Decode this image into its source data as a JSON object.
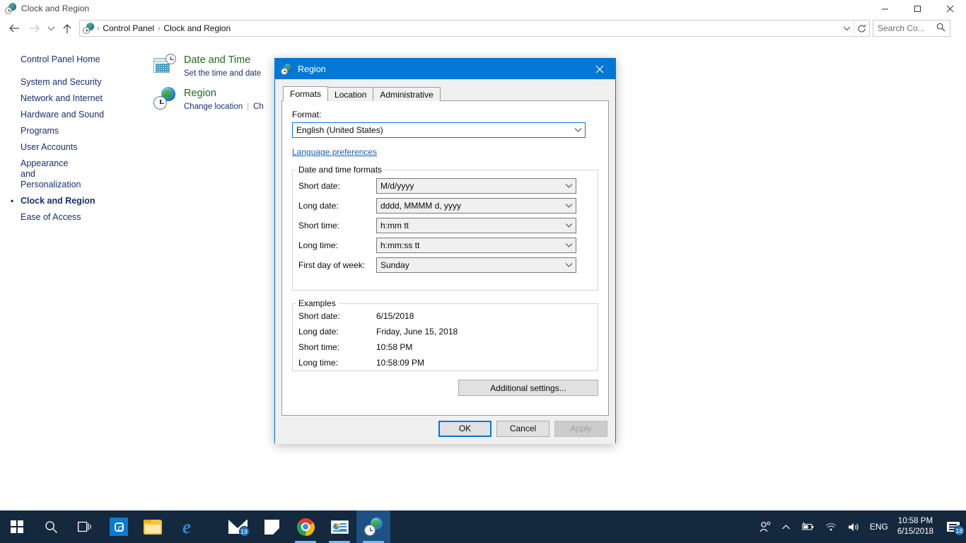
{
  "window": {
    "title": "Clock and Region",
    "icon": "clock-region-icon",
    "buttons": {
      "minimize": "—",
      "maximize": "❑",
      "close": "✕"
    }
  },
  "nav": {
    "back": "←",
    "forward": "→",
    "recent": "⌄",
    "up": "↑",
    "breadcrumb": [
      "Control Panel",
      "Clock and Region"
    ],
    "separator": "›",
    "dropdown": "⌄",
    "refresh": "↻"
  },
  "search": {
    "placeholder": "Search Co...",
    "icon": "search-icon",
    "icon_glyph": "⚲"
  },
  "sidebar": {
    "home": "Control Panel Home",
    "items": [
      {
        "label": "System and Security",
        "current": false
      },
      {
        "label": "Network and Internet",
        "current": false
      },
      {
        "label": "Hardware and Sound",
        "current": false
      },
      {
        "label": "Programs",
        "current": false
      },
      {
        "label": "User Accounts",
        "current": false
      },
      {
        "label": "Appearance and Personalization",
        "current": false
      },
      {
        "label": "Clock and Region",
        "current": true
      },
      {
        "label": "Ease of Access",
        "current": false
      }
    ]
  },
  "content": {
    "items": [
      {
        "title": "Date and Time",
        "icon": "date-and-time-icon",
        "links": [
          "Set the time and date"
        ]
      },
      {
        "title": "Region",
        "icon": "region-icon",
        "links": [
          "Change location",
          "Ch"
        ]
      }
    ]
  },
  "dialog": {
    "title": "Region",
    "icon": "region-icon",
    "close": "✕",
    "tabs": [
      {
        "label": "Formats",
        "active": true
      },
      {
        "label": "Location",
        "active": false
      },
      {
        "label": "Administrative",
        "active": false
      }
    ],
    "format_label": "Format:",
    "format_value": "English (United States)",
    "language_preferences": "Language preferences",
    "datetime_group": {
      "legend": "Date and time formats",
      "rows": [
        {
          "label": "Short date:",
          "value": "M/d/yyyy"
        },
        {
          "label": "Long date:",
          "value": "dddd, MMMM d, yyyy"
        },
        {
          "label": "Short time:",
          "value": "h:mm tt"
        },
        {
          "label": "Long time:",
          "value": "h:mm:ss tt"
        },
        {
          "label": "First day of week:",
          "value": "Sunday"
        }
      ]
    },
    "examples_group": {
      "legend": "Examples",
      "rows": [
        {
          "label": "Short date:",
          "value": "6/15/2018"
        },
        {
          "label": "Long date:",
          "value": "Friday, June 15, 2018"
        },
        {
          "label": "Short time:",
          "value": "10:58 PM"
        },
        {
          "label": "Long time:",
          "value": "10:58:09 PM"
        }
      ]
    },
    "additional_settings": "Additional settings...",
    "ok": "OK",
    "cancel": "Cancel",
    "apply": "Apply",
    "chevron": "⌄",
    "accent_color": "#0078d7"
  },
  "taskbar": {
    "background": "#14293d",
    "start": "start-button",
    "search": "⚲",
    "taskview": "task-view-icon",
    "apps": [
      {
        "name": "photos",
        "running": false
      },
      {
        "name": "file-explorer",
        "running": false
      },
      {
        "name": "edge",
        "running": false
      },
      {
        "name": "mail",
        "running": false,
        "badge": "19"
      },
      {
        "name": "sticky-notes",
        "running": false
      },
      {
        "name": "chrome",
        "running": true
      },
      {
        "name": "powerpoint",
        "running": true
      },
      {
        "name": "region-control-panel",
        "running": true,
        "active": true
      }
    ],
    "tray": {
      "people": "⛹",
      "chevron": "∧",
      "battery": "battery-icon",
      "network": "wifi-icon",
      "volume": "🔊",
      "language": "ENG",
      "time": "10:58 PM",
      "date": "6/15/2018",
      "action_center_badge": "18"
    }
  }
}
